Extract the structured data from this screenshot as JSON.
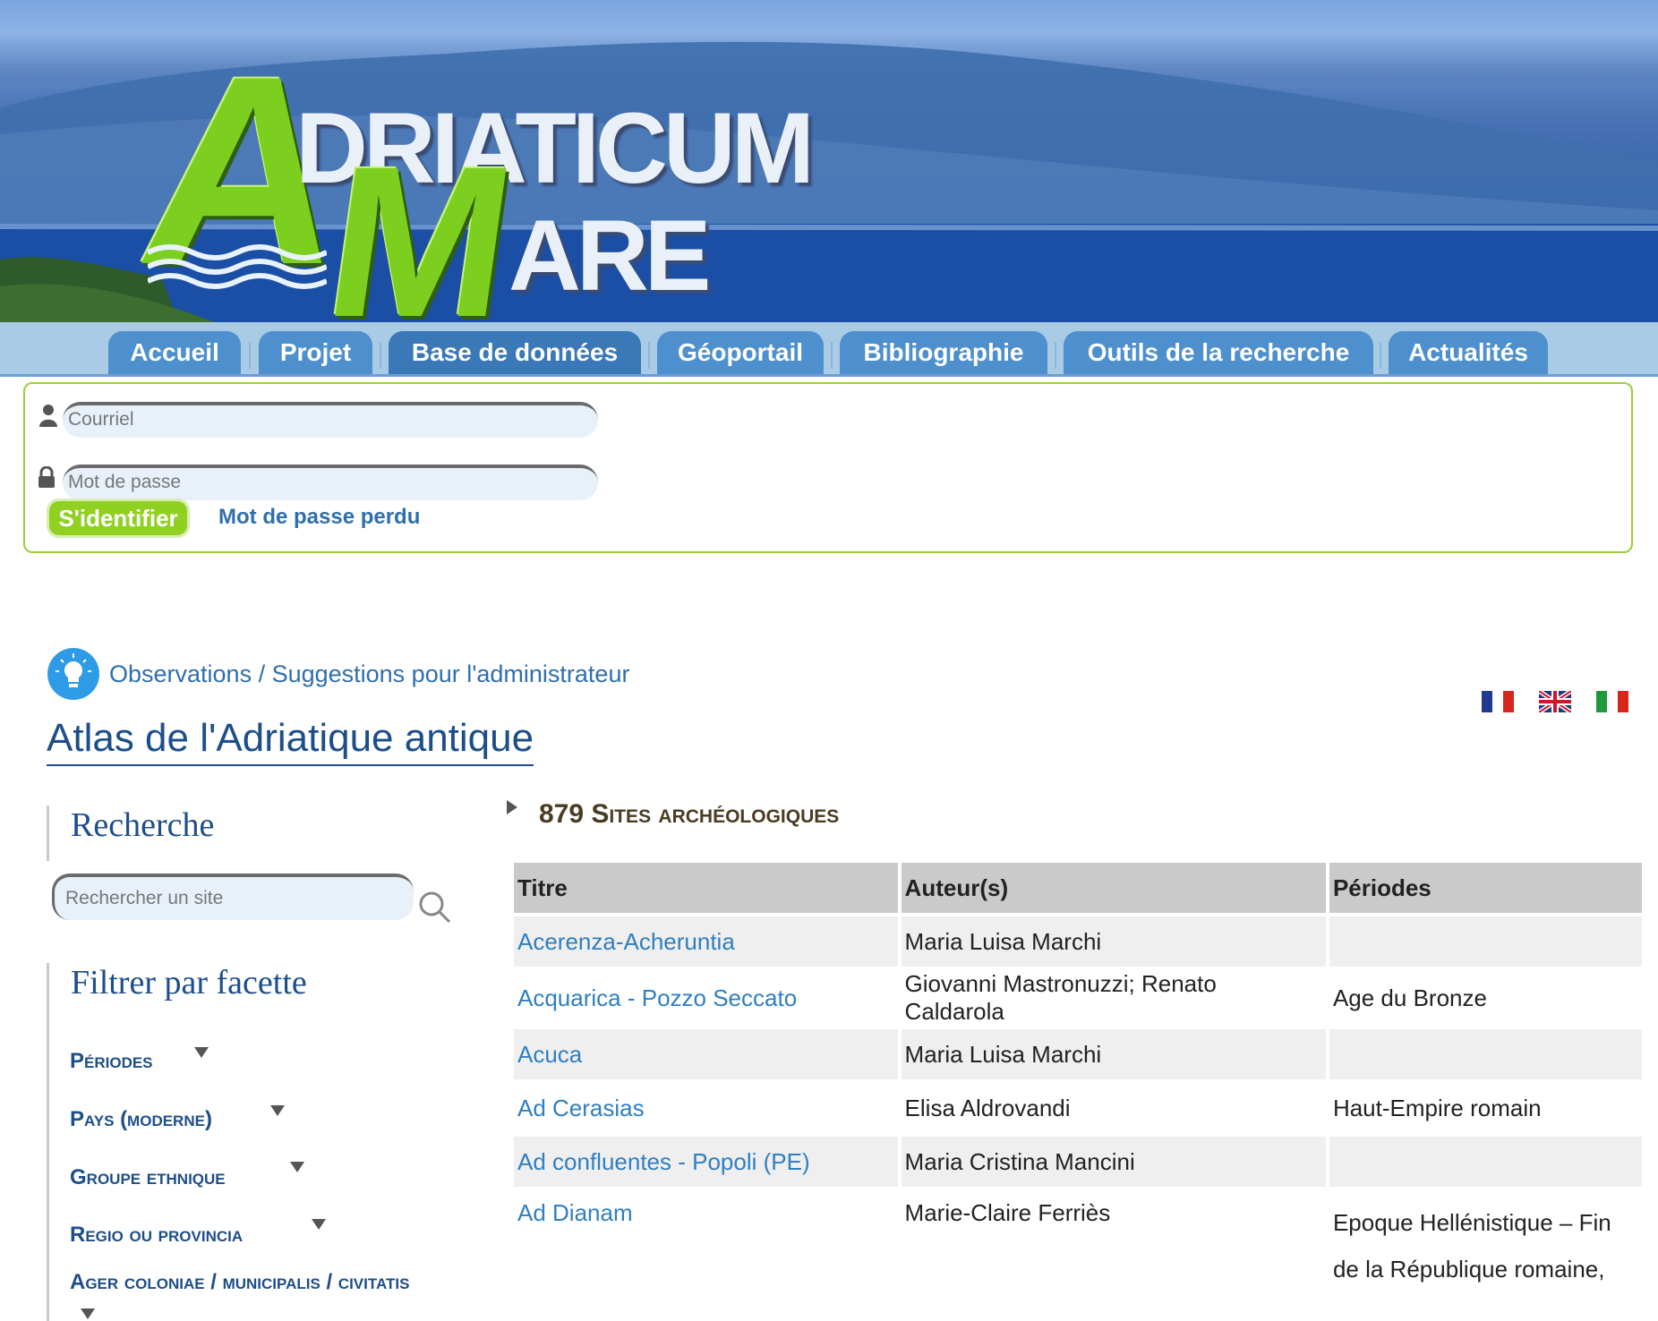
{
  "banner": {
    "logo_line1_cap": "A",
    "logo_line1_rest": "DRIATICUM",
    "logo_line2_cap": "M",
    "logo_line2_rest": "ARE"
  },
  "nav": {
    "tabs": [
      {
        "label": "Accueil"
      },
      {
        "label": "Projet"
      },
      {
        "label": "Base de données",
        "active": true
      },
      {
        "label": "Géoportail"
      },
      {
        "label": "Bibliographie"
      },
      {
        "label": "Outils de la recherche"
      },
      {
        "label": "Actualités"
      }
    ]
  },
  "login": {
    "email_placeholder": "Courriel",
    "password_placeholder": "Mot de passe",
    "signin_label": "S'identifier",
    "lost_password_label": "Mot de passe perdu"
  },
  "feedback": {
    "label": "Observations / Suggestions pour l'administrateur"
  },
  "languages": [
    "fr-flag",
    "en-flag",
    "it-flag"
  ],
  "page": {
    "title": "Atlas de l'Adriatique antique"
  },
  "sidebar": {
    "search_heading": "Recherche",
    "search_placeholder": "Rechercher un site",
    "facet_heading": "Filtrer par facette",
    "facets": [
      "Périodes",
      "Pays (moderne)",
      "Groupe ethnique",
      "Regio ou provincia",
      "Ager coloniae / municipalis / civitatis"
    ]
  },
  "results": {
    "heading": "879 Sites archéologiques",
    "columns": [
      "Titre",
      "Auteur(s)",
      "Périodes"
    ],
    "rows": [
      {
        "title": "Acerenza-Acheruntia",
        "author": "Maria Luisa Marchi",
        "periods": ""
      },
      {
        "title": "Acquarica - Pozzo Seccato",
        "author": "Giovanni Mastronuzzi; Renato Caldarola",
        "periods": "Age du Bronze"
      },
      {
        "title": "Acuca",
        "author": "Maria Luisa Marchi",
        "periods": ""
      },
      {
        "title": "Ad Cerasias",
        "author": "Elisa Aldrovandi",
        "periods": "Haut-Empire romain"
      },
      {
        "title": "Ad confluentes - Popoli (PE)",
        "author": "Maria Cristina Mancini",
        "periods": ""
      },
      {
        "title": "Ad Dianam",
        "author": "Marie-Claire Ferriès",
        "periods": "Epoque Hellénistique – Fin de la République romaine,"
      }
    ]
  },
  "colors": {
    "nav_tab": "#4e90cd",
    "link": "#2f7fc1",
    "heading": "#1d4e8a",
    "signin": "#8fd021",
    "login_border": "#9ccc3d"
  }
}
